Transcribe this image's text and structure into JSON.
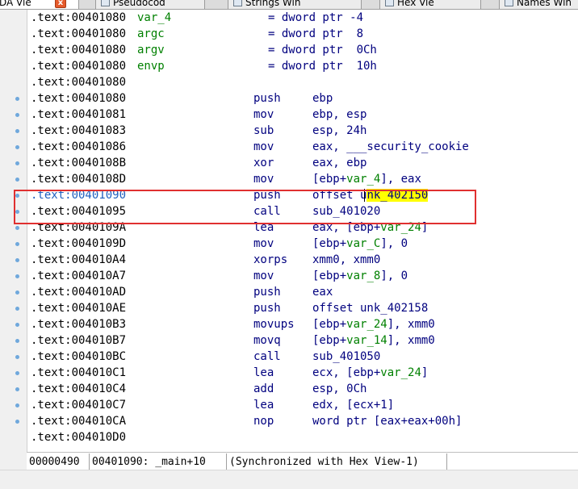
{
  "tabs": [
    {
      "label": "DA Vie",
      "active": true
    },
    {
      "label": "Pseudocod"
    },
    {
      "label": "Strings Win"
    },
    {
      "label": "Hex Vie"
    },
    {
      "label": "Names Win"
    }
  ],
  "close_label": "x",
  "vars": [
    {
      "addr": ".text:00401080",
      "name": "var_4",
      "op": "= dword ptr -4"
    },
    {
      "addr": ".text:00401080",
      "name": "argc",
      "op": "= dword ptr  8"
    },
    {
      "addr": ".text:00401080",
      "name": "argv",
      "op": "= dword ptr  0Ch"
    },
    {
      "addr": ".text:00401080",
      "name": "envp",
      "op": "= dword ptr  10h"
    }
  ],
  "blank_line": ".text:00401080",
  "instructions": [
    {
      "addr": ".text:00401080",
      "mnem": "push",
      "ops": "ebp"
    },
    {
      "addr": ".text:00401081",
      "mnem": "mov",
      "ops": "ebp, esp"
    },
    {
      "addr": ".text:00401083",
      "mnem": "sub",
      "ops": "esp, 24h"
    },
    {
      "addr": ".text:00401086",
      "mnem": "mov",
      "ops": "eax, ___security_cookie"
    },
    {
      "addr": ".text:0040108B",
      "mnem": "xor",
      "ops": "eax, ebp"
    },
    {
      "addr": ".text:0040108D",
      "mnem": "mov",
      "ops": "[ebp+var_4], eax"
    },
    {
      "addr": ".text:00401090",
      "mnem": "push",
      "ops": "offset unk_402150"
    },
    {
      "addr": ".text:00401095",
      "mnem": "call",
      "ops": "sub_401020"
    },
    {
      "addr": ".text:0040109A",
      "mnem": "lea",
      "ops": "eax, [ebp+var_24]"
    },
    {
      "addr": ".text:0040109D",
      "mnem": "mov",
      "ops": "[ebp+var_C], 0"
    },
    {
      "addr": ".text:004010A4",
      "mnem": "xorps",
      "ops": "xmm0, xmm0"
    },
    {
      "addr": ".text:004010A7",
      "mnem": "mov",
      "ops": "[ebp+var_8], 0"
    },
    {
      "addr": ".text:004010AD",
      "mnem": "push",
      "ops": "eax"
    },
    {
      "addr": ".text:004010AE",
      "mnem": "push",
      "ops": "offset unk_402158"
    },
    {
      "addr": ".text:004010B3",
      "mnem": "movups",
      "ops": "[ebp+var_24], xmm0"
    },
    {
      "addr": ".text:004010B7",
      "mnem": "movq",
      "ops": "[ebp+var_14], xmm0"
    },
    {
      "addr": ".text:004010BC",
      "mnem": "call",
      "ops": "sub_401050"
    },
    {
      "addr": ".text:004010C1",
      "mnem": "lea",
      "ops": "ecx, [ebp+var_24]"
    },
    {
      "addr": ".text:004010C4",
      "mnem": "add",
      "ops": "esp, 0Ch"
    },
    {
      "addr": ".text:004010C7",
      "mnem": "lea",
      "ops": "edx, [ecx+1]"
    },
    {
      "addr": ".text:004010CA",
      "mnem": "nop",
      "ops": "word ptr [eax+eax+00h]"
    }
  ],
  "end_line": ".text:004010D0",
  "highlight": {
    "prefix": "offset u",
    "marked": "nk_402150"
  },
  "status": {
    "offset": "00000490",
    "location": "00401090: _main+10",
    "sync": "(Synchronized with Hex View-1)"
  },
  "colors": {
    "selection_box": "#e03030",
    "highlight": "#ffff00",
    "mnemonic": "#00007f",
    "name": "#008000",
    "selected_address": "#1f5fbf"
  }
}
